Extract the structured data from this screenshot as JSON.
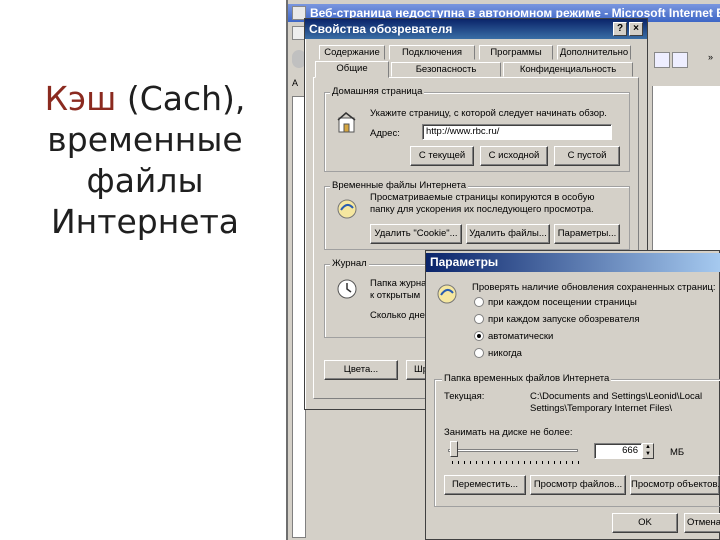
{
  "slide": {
    "title_accent": "Кэш",
    "title_line1_rest": " (Cach),",
    "title_line2": "временные",
    "title_line3": "файлы",
    "title_line4": "Интернета"
  },
  "browser": {
    "title": "Веб-страница недоступна в автономном режиме - Microsoft Internet Explorer"
  },
  "props_dialog": {
    "title": "Свойства обозревателя",
    "help_btn": "?",
    "close_btn": "×",
    "tabs_row1": [
      "Содержание",
      "Подключения",
      "Программы",
      "Дополнительно"
    ],
    "tabs_row2": [
      "Общие",
      "Безопасность",
      "Конфиденциальность"
    ],
    "home": {
      "group": "Домашняя страница",
      "desc": "Укажите страницу, с которой следует начинать обзор.",
      "addr_label": "Адрес:",
      "addr_value": "http://www.rbc.ru/",
      "btn_current": "С текущей",
      "btn_default": "С исходной",
      "btn_blank": "С пустой"
    },
    "temp": {
      "group": "Временные файлы Интернета",
      "desc1": "Просматриваемые страницы копируются в особую",
      "desc2": "папку для ускорения их последующего просмотра.",
      "btn_cookies": "Удалить \"Cookie\"...",
      "btn_files": "Удалить файлы...",
      "btn_settings": "Параметры..."
    },
    "journal": {
      "group": "Журнал",
      "desc1": "Папка журнала",
      "desc2": "к открытым",
      "days_label": "Сколько дней",
      "btn_colors": "Цвета...",
      "btn_fonts": "Шр"
    }
  },
  "settings_dialog": {
    "title": "Параметры",
    "check_label1": "Проверять наличие обновления сохраненных страниц:",
    "options": [
      "при каждом посещении страницы",
      "при каждом запуске обозревателя",
      "автоматически",
      "никогда"
    ],
    "selected_index": 2,
    "folder_group": "Папка временных файлов Интернета",
    "current_label": "Текущая:",
    "current_path1": "C:\\Documents and Settings\\Leonid\\Local",
    "current_path2": "Settings\\Temporary Internet Files\\",
    "disk_label": "Занимать на диске не более:",
    "disk_value": "666",
    "disk_unit": "МБ",
    "slider_fraction": 0.02,
    "btn_move": "Переместить...",
    "btn_view_files": "Просмотр файлов...",
    "btn_view_objects": "Просмотр объектов...",
    "btn_ok": "OK",
    "btn_cancel": "Отмена"
  }
}
